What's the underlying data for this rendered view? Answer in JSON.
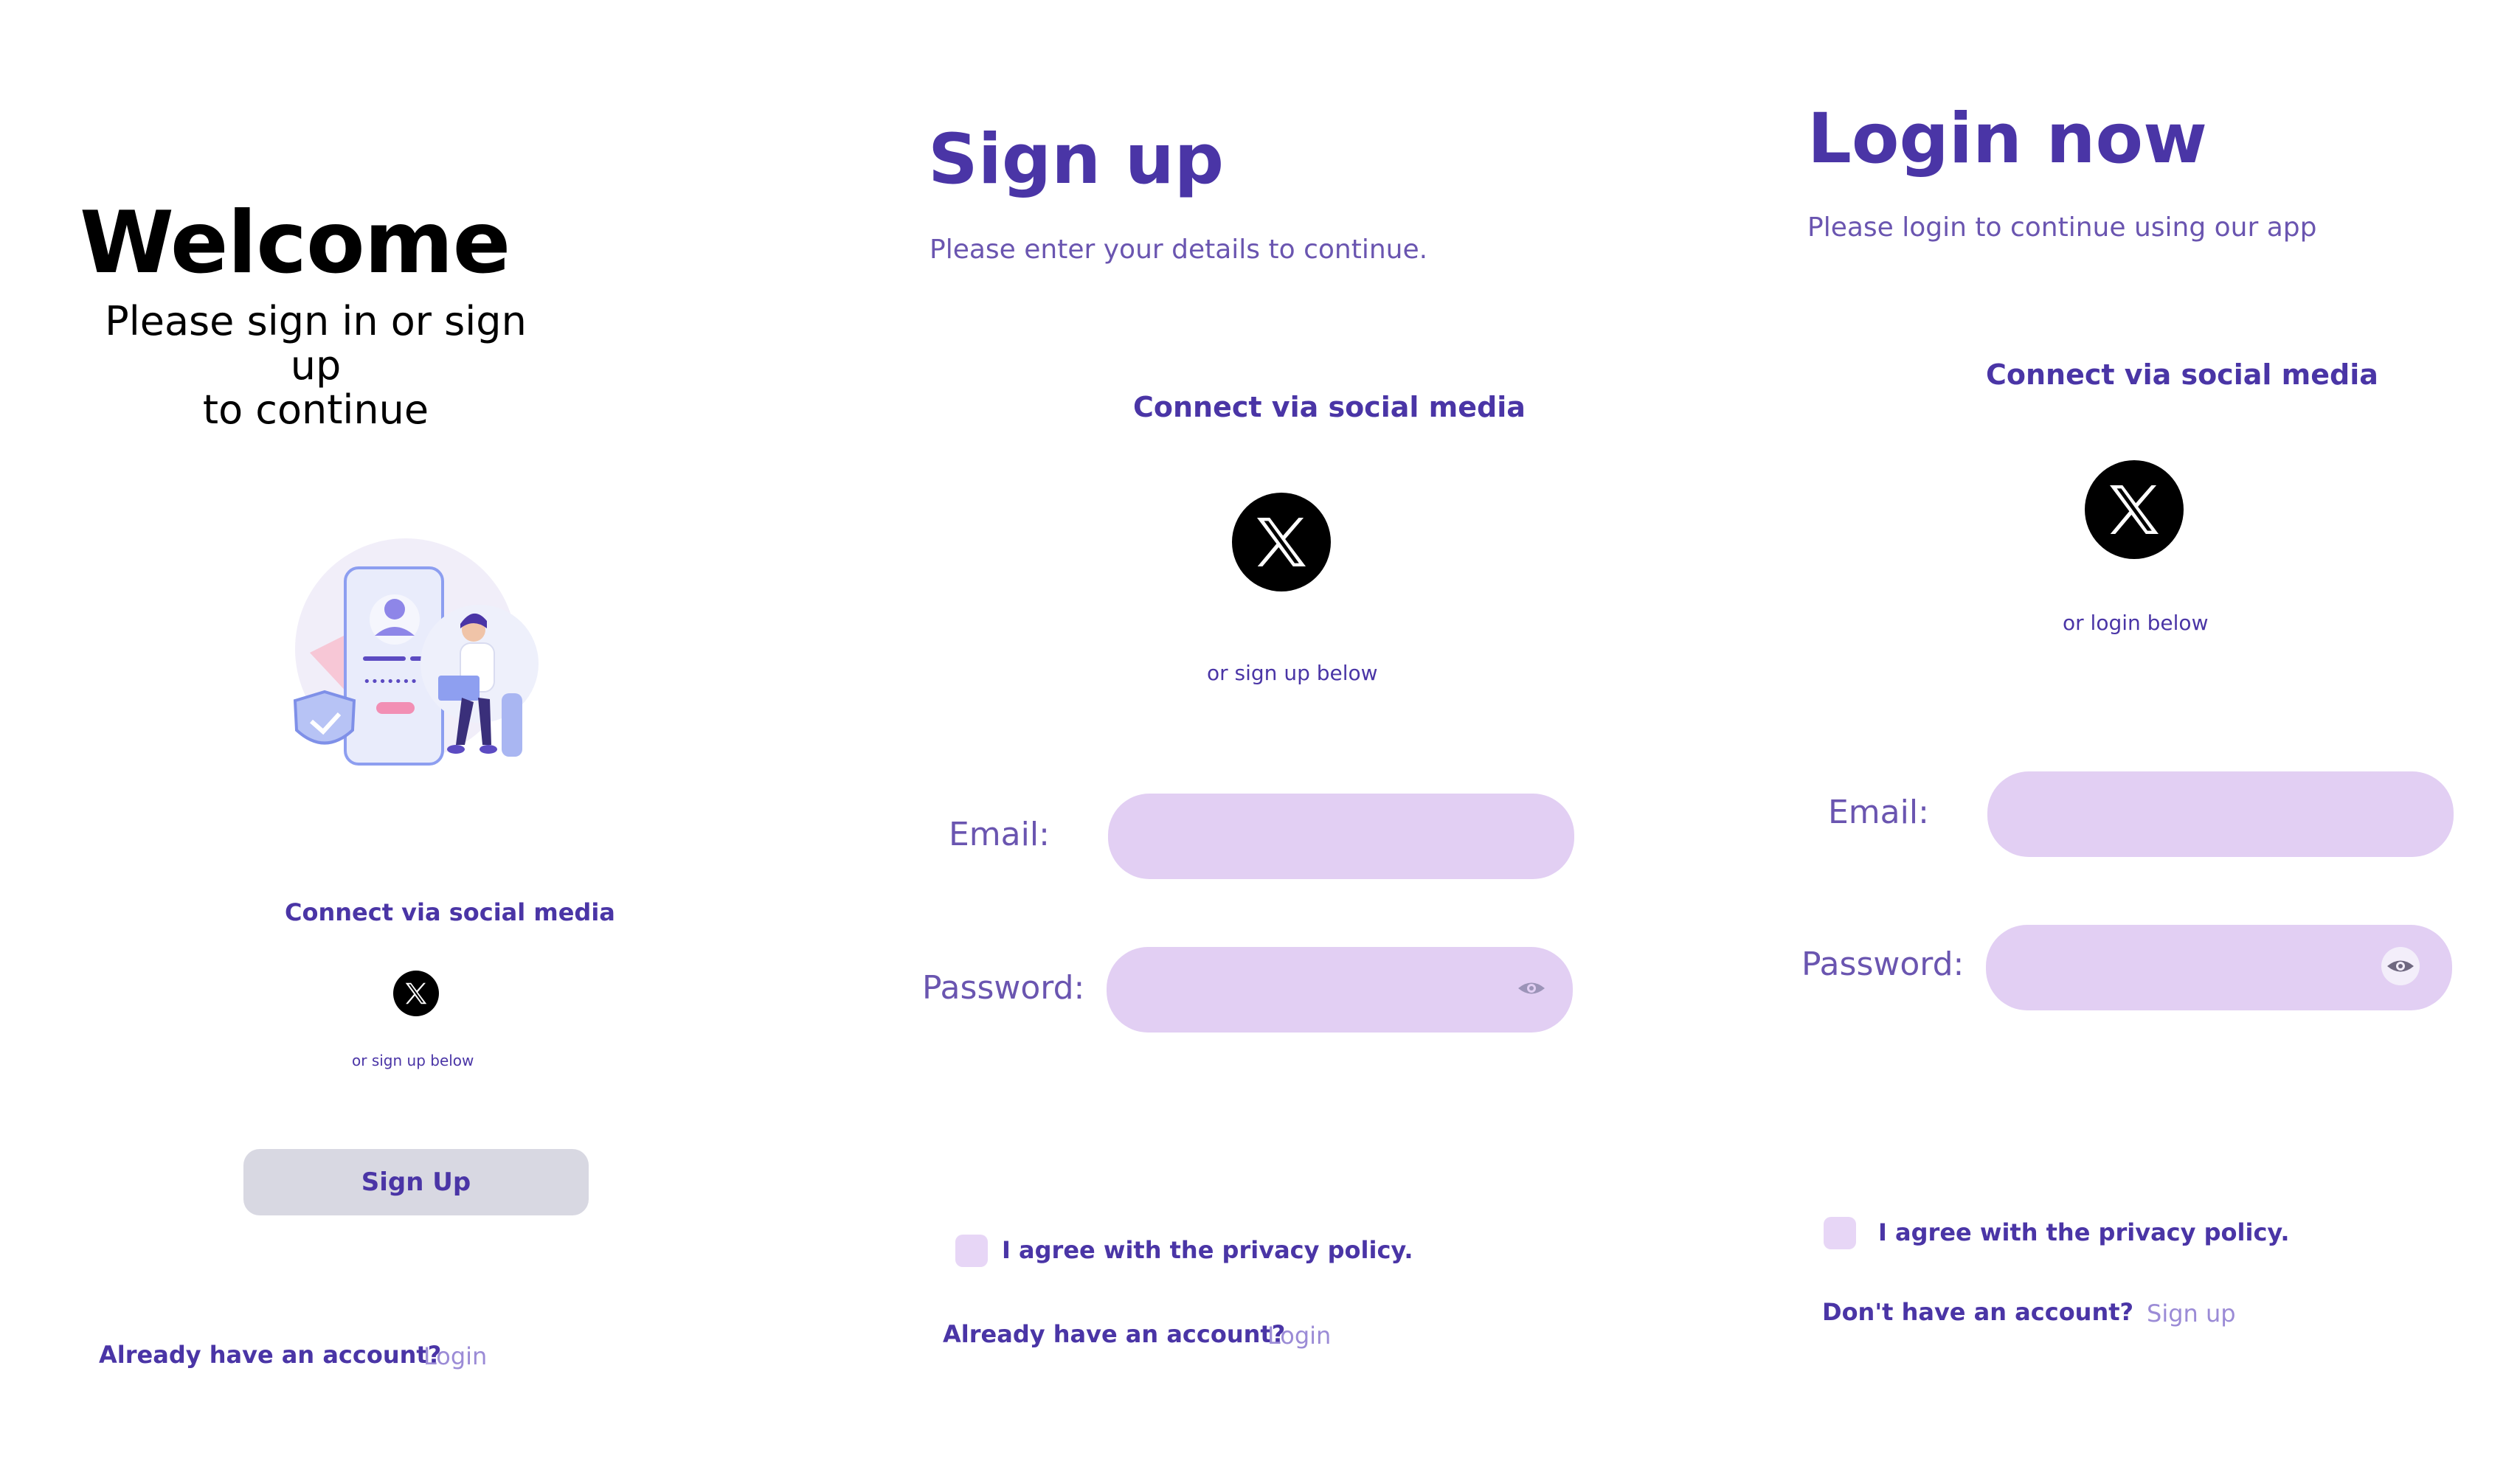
{
  "welcome": {
    "title": "Welcome",
    "subtitle_line1": "Please sign in or sign up",
    "subtitle_line2": "to continue",
    "connect_label": "Connect via social media",
    "or_text": "or sign up below",
    "signup_button": "Sign Up",
    "have_account": "Already have an account?",
    "login_link": "Login"
  },
  "signup": {
    "title": "Sign up",
    "subtitle": "Please enter your details to continue.",
    "connect_label": "Connect via social media",
    "or_text": "or sign up below",
    "email_label": "Email:",
    "password_label": "Password:",
    "email_value": "",
    "password_value": "",
    "privacy_label": "I agree with the privacy policy.",
    "have_account": "Already have an account?",
    "login_link": "Login"
  },
  "login": {
    "title": "Login now",
    "subtitle": "Please login to continue using our app",
    "connect_label": "Connect via social media",
    "or_text": "or login below",
    "email_label": "Email:",
    "password_label": "Password:",
    "email_value": "",
    "password_value": "",
    "privacy_label": "I agree with the privacy policy.",
    "no_account": "Don't have an account?",
    "signup_link": "Sign up"
  },
  "icons": {
    "social": "x-logo-icon",
    "password_toggle": "eye-icon",
    "illustration": "user-laptop-illustration"
  },
  "colors": {
    "accent": "#4a35a6",
    "field_bg": "#e2cff3",
    "button_bg": "#d8d8e2",
    "link": "#9b8bd6"
  }
}
